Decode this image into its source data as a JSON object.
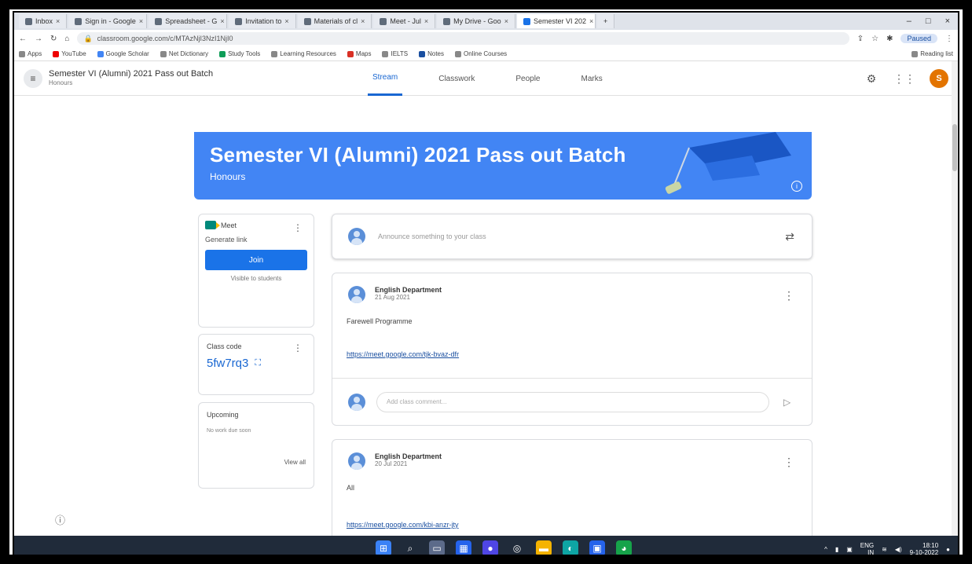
{
  "browser": {
    "tabs": [
      {
        "label": "Inbox",
        "active": false
      },
      {
        "label": "Sign in - Google",
        "active": false
      },
      {
        "label": "Spreadsheet - G",
        "active": false
      },
      {
        "label": "Invitation to",
        "active": false
      },
      {
        "label": "Materials of cl",
        "active": false
      },
      {
        "label": "Meet - Jul",
        "active": false
      },
      {
        "label": "My Drive - Goo",
        "active": false
      },
      {
        "label": "Semester VI 202",
        "active": true
      }
    ],
    "url": "classroom.google.com/c/MTAzNjI3NzI1NjI0",
    "profile_label": "Paused",
    "bookmarks": [
      "Apps",
      "YouTube",
      "Google Scholar",
      "Net Dictionary",
      "Study Tools",
      "Learning Resources",
      "Maps",
      "IELTS",
      "Notes",
      "Online Courses"
    ],
    "reading_list": "Reading list"
  },
  "classroom": {
    "header_title": "Semester VI (Alumni) 2021 Pass out Batch",
    "header_subtitle": "Honours",
    "nav_tabs": [
      "Stream",
      "Classwork",
      "People",
      "Marks"
    ],
    "active_tab": "Stream",
    "avatar_initial": "S"
  },
  "banner": {
    "title": "Semester VI (Alumni) 2021 Pass out Batch",
    "subtitle": "Honours"
  },
  "meet": {
    "label": "Meet",
    "link_text": "Generate link",
    "join_label": "Join",
    "visibility_note": "Visible to students"
  },
  "class_code": {
    "label": "Class code",
    "value": "5fw7rq3"
  },
  "upcoming": {
    "label": "Upcoming",
    "empty_text": "No work due soon",
    "view_all": "View all"
  },
  "announce": {
    "placeholder": "Announce something to your class"
  },
  "posts": [
    {
      "author": "English Department",
      "date": "21 Aug 2021",
      "body": "Farewell Programme",
      "link": "https://meet.google.com/tjk-bvaz-dfr",
      "comment_placeholder": "Add class comment..."
    },
    {
      "author": "English Department",
      "date": "20 Jul 2021",
      "body": "All",
      "link": "https://meet.google.com/kbi-anzr-jty"
    }
  ],
  "taskbar": {
    "lang": "ENG",
    "region": "IN",
    "time": "18:10",
    "date": "9-10-2022"
  },
  "colors": {
    "accent": "#1a73e8",
    "banner": "#4285f4",
    "avatar": "#e37400",
    "taskbar": "#202b3a"
  }
}
